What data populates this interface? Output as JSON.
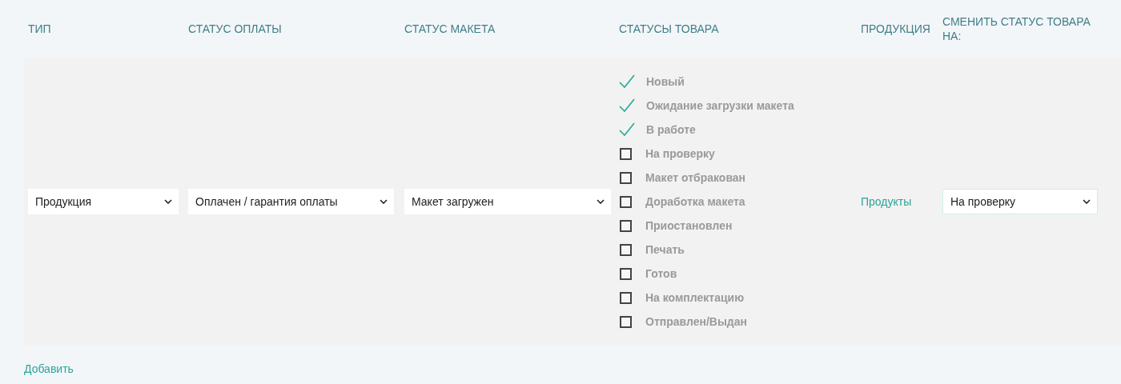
{
  "columns": [
    "ТИП",
    "СТАТУС ОПЛАТЫ",
    "СТАТУС МАКЕТА",
    "СТАТУСЫ ТОВАРА",
    "ПРОДУКЦИЯ",
    "СМЕНИТЬ СТАТУС ТОВАРА НА:"
  ],
  "row": {
    "type": {
      "value": "Продукция"
    },
    "payment_status": {
      "value": "Оплачен / гарантия оплаты"
    },
    "layout_status": {
      "value": "Макет загружен"
    },
    "statuses": [
      {
        "label": "Новый",
        "checked": true
      },
      {
        "label": "Ожидание загрузки макета",
        "checked": true
      },
      {
        "label": "В работе",
        "checked": true
      },
      {
        "label": "На проверку",
        "checked": false
      },
      {
        "label": "Макет отбракован",
        "checked": false
      },
      {
        "label": "Доработка макета",
        "checked": false
      },
      {
        "label": "Приостановлен",
        "checked": false
      },
      {
        "label": "Печать",
        "checked": false
      },
      {
        "label": "Готов",
        "checked": false
      },
      {
        "label": "На комплектацию",
        "checked": false
      },
      {
        "label": "Отправлен/Выдан",
        "checked": false
      }
    ],
    "product_link": "Продукты",
    "change_status": {
      "value": "На проверку"
    }
  },
  "add_link": "Добавить"
}
